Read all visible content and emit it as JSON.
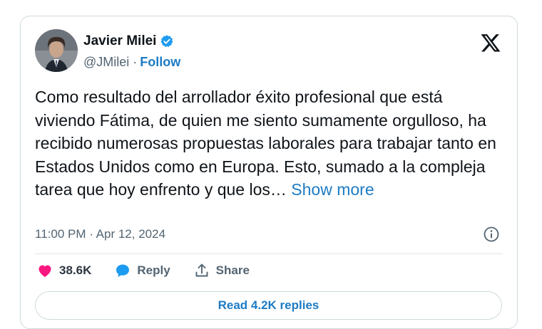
{
  "author": {
    "name": "Javier Milei",
    "handle": "@JMilei",
    "separator": "·",
    "follow_label": "Follow"
  },
  "tweet": {
    "text": "Como resultado del arrollador éxito profesional que está viviendo Fátima, de quien me siento sumamente orgulloso, ha recibido numerosas propuestas laborales para trabajar tanto en Estados Unidos como en Europa. Esto, sumado a la compleja tarea que hoy enfrento y que los…",
    "show_more_label": "Show more",
    "timestamp": "11:00 PM · Apr 12, 2024"
  },
  "actions": {
    "likes_count": "38.6K",
    "reply_label": "Reply",
    "share_label": "Share"
  },
  "read_replies_label": "Read 4.2K replies",
  "colors": {
    "accent": "#1d7bc4",
    "like": "#f91880",
    "verified": "#1d9bf0",
    "muted": "#536471"
  },
  "icons": {
    "verified": "verified-badge-icon",
    "logo": "x-logo-icon",
    "info": "info-icon",
    "like": "heart-icon",
    "reply": "speech-bubble-icon",
    "share": "share-upload-icon"
  }
}
